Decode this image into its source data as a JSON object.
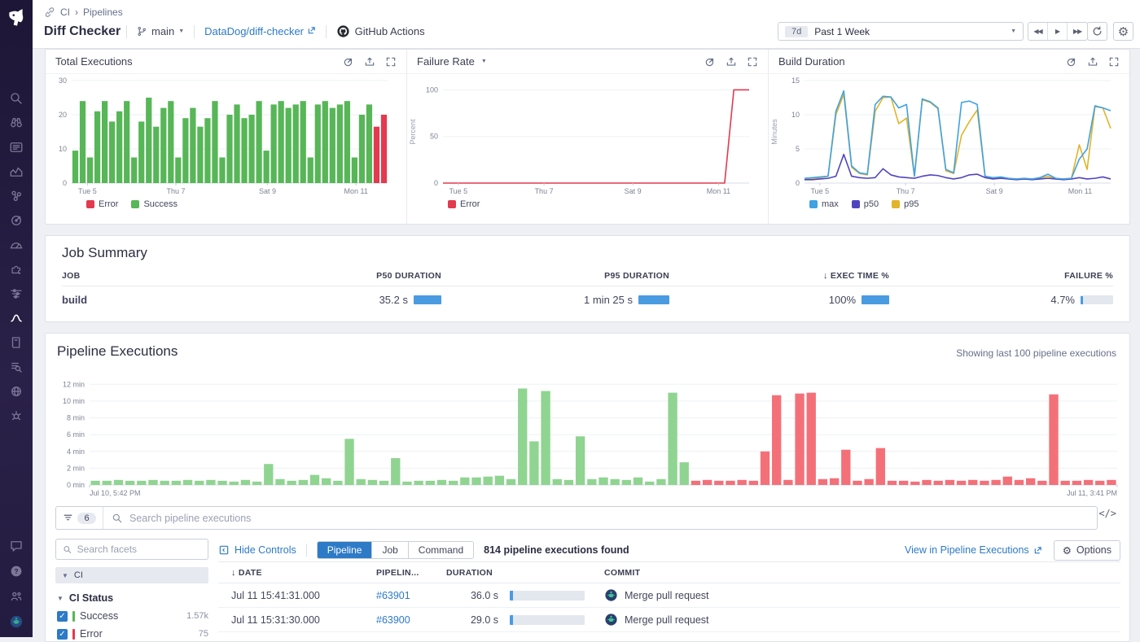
{
  "header": {
    "breadcrumb": {
      "section": "CI",
      "separator": "›",
      "page": "Pipelines"
    },
    "title": "Diff Checker",
    "branch_label": "main",
    "repo_link_label": "DataDog/diff-checker",
    "provider_label": "GitHub Actions",
    "time": {
      "badge": "7d",
      "label": "Past 1 Week"
    }
  },
  "icons": {
    "sort_desc": "↓",
    "check": "✓",
    "caret_down": "▼",
    "code": "</>",
    "gear": "⚙",
    "play": "▶",
    "rew": "◀◀",
    "ffwd": "▶▶",
    "help": "?"
  },
  "chart_data": [
    {
      "name": "total-executions",
      "type": "bar",
      "title": "Total Executions",
      "ylim": [
        0,
        30
      ],
      "yticks": [
        0,
        10,
        20,
        30
      ],
      "xticks": [
        {
          "label": "Tue 5",
          "x": 5
        },
        {
          "label": "Thu 7",
          "x": 33
        },
        {
          "label": "Sat 9",
          "x": 62
        },
        {
          "label": "Mon 11",
          "x": 90
        }
      ],
      "colors": {
        "g": "#57b657",
        "r": "#e23a4f"
      },
      "bars": [
        [
          9.5,
          "g"
        ],
        [
          24,
          "g"
        ],
        [
          7.5,
          "g"
        ],
        [
          21,
          "g"
        ],
        [
          24,
          "g"
        ],
        [
          18,
          "g"
        ],
        [
          21,
          "g"
        ],
        [
          24,
          "g"
        ],
        [
          7.5,
          "g"
        ],
        [
          18,
          "g"
        ],
        [
          25,
          "g"
        ],
        [
          16.5,
          "g"
        ],
        [
          22,
          "g"
        ],
        [
          24,
          "g"
        ],
        [
          7.5,
          "g"
        ],
        [
          19,
          "g"
        ],
        [
          22,
          "g"
        ],
        [
          16.5,
          "g"
        ],
        [
          19,
          "g"
        ],
        [
          24,
          "g"
        ],
        [
          7.5,
          "g"
        ],
        [
          20,
          "g"
        ],
        [
          23,
          "g"
        ],
        [
          19,
          "g"
        ],
        [
          20,
          "g"
        ],
        [
          24,
          "g"
        ],
        [
          9.5,
          "g"
        ],
        [
          23,
          "g"
        ],
        [
          24,
          "g"
        ],
        [
          22,
          "g"
        ],
        [
          23,
          "g"
        ],
        [
          24,
          "g"
        ],
        [
          7.5,
          "g"
        ],
        [
          23,
          "g"
        ],
        [
          24,
          "g"
        ],
        [
          22,
          "g"
        ],
        [
          23,
          "g"
        ],
        [
          24,
          "g"
        ],
        [
          7.5,
          "g"
        ],
        [
          20,
          "g"
        ],
        [
          23,
          "g"
        ],
        [
          16.5,
          "r"
        ],
        [
          20,
          "r"
        ]
      ],
      "legend": [
        {
          "label": "Error",
          "color": "#e23a4f"
        },
        {
          "label": "Success",
          "color": "#57b657"
        }
      ]
    },
    {
      "name": "failure-rate",
      "type": "line",
      "title": "Failure Rate",
      "ylabel": "Percent",
      "ylim": [
        0,
        110
      ],
      "yticks": [
        0,
        50,
        100
      ],
      "xticks": [
        {
          "label": "Tue 5",
          "x": 5
        },
        {
          "label": "Thu 7",
          "x": 33
        },
        {
          "label": "Sat 9",
          "x": 62
        },
        {
          "label": "Mon 11",
          "x": 90
        }
      ],
      "series": [
        {
          "name": "Error",
          "color": "#e23a4f",
          "points": [
            [
              0,
              0
            ],
            [
              50,
              0
            ],
            [
              92,
              0
            ],
            [
              95,
              100
            ],
            [
              100,
              100
            ]
          ]
        }
      ],
      "legend": [
        {
          "label": "Error",
          "color": "#e23a4f"
        }
      ]
    },
    {
      "name": "build-duration",
      "type": "line",
      "title": "Build Duration",
      "ylabel": "Minutes",
      "ylim": [
        0,
        15
      ],
      "yticks": [
        0,
        5,
        10,
        15
      ],
      "xticks": [
        {
          "label": "Tue 5",
          "x": 5
        },
        {
          "label": "Thu 7",
          "x": 33
        },
        {
          "label": "Sat 9",
          "x": 62
        },
        {
          "label": "Mon 11",
          "x": 90
        }
      ],
      "series": [
        {
          "name": "p95",
          "color": "#e3b32a",
          "values": [
            0.6,
            0.7,
            0.8,
            1.0,
            10.0,
            13.0,
            2.3,
            1.4,
            1.2,
            10.5,
            12.5,
            12.6,
            8.7,
            9.5,
            1.0,
            12.2,
            11.8,
            10.9,
            1.8,
            1.4,
            7.0,
            9.0,
            10.7,
            0.9,
            0.7,
            0.8,
            0.6,
            0.6,
            0.6,
            0.6,
            0.7,
            1.0,
            0.6,
            0.6,
            0.7,
            5.6,
            2.0,
            11.2,
            11.0,
            8.0
          ]
        },
        {
          "name": "p50",
          "color": "#4f44c0",
          "values": [
            0.5,
            0.5,
            0.6,
            0.7,
            1.0,
            4.2,
            1.0,
            0.8,
            0.7,
            0.8,
            2.1,
            1.2,
            0.9,
            0.8,
            0.7,
            1.0,
            1.2,
            1.1,
            0.8,
            0.6,
            0.8,
            1.2,
            1.3,
            0.8,
            0.6,
            0.7,
            0.6,
            0.5,
            0.6,
            0.5,
            0.6,
            0.7,
            0.6,
            0.5,
            0.6,
            0.8,
            0.6,
            0.7,
            0.9,
            0.6
          ]
        },
        {
          "name": "max",
          "color": "#3fa2e2",
          "values": [
            0.7,
            0.8,
            0.9,
            1.0,
            10.5,
            13.5,
            2.5,
            1.5,
            1.3,
            11.5,
            12.7,
            12.6,
            11.0,
            11.5,
            1.0,
            12.3,
            11.9,
            11.0,
            2.0,
            1.5,
            11.8,
            12.0,
            11.5,
            1.0,
            0.8,
            0.9,
            0.7,
            0.6,
            0.7,
            0.6,
            0.8,
            1.3,
            0.7,
            0.6,
            0.7,
            3.5,
            5.0,
            11.3,
            11.0,
            10.6
          ]
        }
      ],
      "legend": [
        {
          "label": "max",
          "color": "#3fa2e2"
        },
        {
          "label": "p50",
          "color": "#4f44c0"
        },
        {
          "label": "p95",
          "color": "#e3b32a"
        }
      ]
    },
    {
      "name": "pipeline-durations",
      "type": "bar",
      "title": "Pipeline Executions durations",
      "ylim": [
        0,
        13
      ],
      "yticks": [
        0,
        2,
        4,
        6,
        8,
        10,
        12
      ],
      "ytick_suffix": " min",
      "xticks": [
        {
          "label": "Jul 10, 5:42 PM",
          "x": 0,
          "anchor": "start"
        },
        {
          "label": "Jul 11, 3:41 PM",
          "x": 100,
          "anchor": "end"
        }
      ],
      "colors": {
        "g": "#90d492",
        "r": "#f47079"
      },
      "bars": [
        [
          0.5,
          "g"
        ],
        [
          0.5,
          "g"
        ],
        [
          0.6,
          "g"
        ],
        [
          0.5,
          "g"
        ],
        [
          0.5,
          "g"
        ],
        [
          0.6,
          "g"
        ],
        [
          0.5,
          "g"
        ],
        [
          0.5,
          "g"
        ],
        [
          0.6,
          "g"
        ],
        [
          0.5,
          "g"
        ],
        [
          0.6,
          "g"
        ],
        [
          0.5,
          "g"
        ],
        [
          0.4,
          "g"
        ],
        [
          0.6,
          "g"
        ],
        [
          0.4,
          "g"
        ],
        [
          2.5,
          "g"
        ],
        [
          0.7,
          "g"
        ],
        [
          0.5,
          "g"
        ],
        [
          0.6,
          "g"
        ],
        [
          1.2,
          "g"
        ],
        [
          0.8,
          "g"
        ],
        [
          0.5,
          "g"
        ],
        [
          5.5,
          "g"
        ],
        [
          0.7,
          "g"
        ],
        [
          0.6,
          "g"
        ],
        [
          0.5,
          "g"
        ],
        [
          3.2,
          "g"
        ],
        [
          0.4,
          "g"
        ],
        [
          0.5,
          "g"
        ],
        [
          0.5,
          "g"
        ],
        [
          0.6,
          "g"
        ],
        [
          0.5,
          "g"
        ],
        [
          0.9,
          "g"
        ],
        [
          0.9,
          "g"
        ],
        [
          1.0,
          "g"
        ],
        [
          1.1,
          "g"
        ],
        [
          0.7,
          "g"
        ],
        [
          11.5,
          "g"
        ],
        [
          5.2,
          "g"
        ],
        [
          11.2,
          "g"
        ],
        [
          0.7,
          "g"
        ],
        [
          0.6,
          "g"
        ],
        [
          5.8,
          "g"
        ],
        [
          0.7,
          "g"
        ],
        [
          0.9,
          "g"
        ],
        [
          0.7,
          "g"
        ],
        [
          0.6,
          "g"
        ],
        [
          0.9,
          "g"
        ],
        [
          0.4,
          "g"
        ],
        [
          0.7,
          "g"
        ],
        [
          11.0,
          "g"
        ],
        [
          2.7,
          "g"
        ],
        [
          0.5,
          "r"
        ],
        [
          0.6,
          "r"
        ],
        [
          0.5,
          "r"
        ],
        [
          0.5,
          "r"
        ],
        [
          0.6,
          "r"
        ],
        [
          0.5,
          "r"
        ],
        [
          4.0,
          "r"
        ],
        [
          10.7,
          "r"
        ],
        [
          0.6,
          "r"
        ],
        [
          10.9,
          "r"
        ],
        [
          11.0,
          "r"
        ],
        [
          0.7,
          "r"
        ],
        [
          0.8,
          "r"
        ],
        [
          4.2,
          "r"
        ],
        [
          0.5,
          "r"
        ],
        [
          0.7,
          "r"
        ],
        [
          4.4,
          "r"
        ],
        [
          0.5,
          "r"
        ],
        [
          0.5,
          "r"
        ],
        [
          0.4,
          "r"
        ],
        [
          0.6,
          "r"
        ],
        [
          0.5,
          "r"
        ],
        [
          0.6,
          "r"
        ],
        [
          0.5,
          "r"
        ],
        [
          0.6,
          "r"
        ],
        [
          0.5,
          "r"
        ],
        [
          0.6,
          "r"
        ],
        [
          1.0,
          "r"
        ],
        [
          0.6,
          "r"
        ],
        [
          0.8,
          "r"
        ],
        [
          0.5,
          "r"
        ],
        [
          10.8,
          "r"
        ],
        [
          0.5,
          "r"
        ],
        [
          0.5,
          "r"
        ],
        [
          0.6,
          "r"
        ],
        [
          0.5,
          "r"
        ],
        [
          0.6,
          "r"
        ]
      ],
      "legend": []
    }
  ],
  "job_summary": {
    "title": "Job Summary",
    "columns": {
      "job": "JOB",
      "p50": "P50 DURATION",
      "p95": "P95 DURATION",
      "exec": "EXEC TIME %",
      "failure": "FAILURE %"
    },
    "rows": [
      {
        "job": "build",
        "p50": "35.2 s",
        "p50_bar": 34,
        "p95": "1 min 25 s",
        "p95_bar": 38,
        "exec": "100%",
        "exec_bar": 34,
        "failure": "4.7%",
        "failure_bar": 3
      }
    ]
  },
  "pipeline_section": {
    "title": "Pipeline Executions",
    "subtitle": "Showing last 100 pipeline executions",
    "filter_count": "6",
    "search_placeholder": "Search pipeline executions",
    "facets": {
      "search_placeholder": "Search facets",
      "group": "CI",
      "subgroup": "CI Status",
      "items": [
        {
          "label": "Success",
          "count": "1.57k",
          "color": "#57b657"
        },
        {
          "label": "Error",
          "count": "75",
          "color": "#e23a4f"
        }
      ]
    },
    "controls": {
      "hide": "Hide Controls",
      "tabs": [
        "Pipeline",
        "Job",
        "Command"
      ],
      "active_tab": "Pipeline",
      "count": "814 pipeline executions found",
      "view": "View in Pipeline Executions",
      "options": "Options"
    },
    "table": {
      "columns": {
        "date": "DATE",
        "pipeline": "PIPELIN...",
        "duration": "DURATION",
        "commit": "COMMIT"
      },
      "rows": [
        {
          "date": "Jul 11 15:41:31.000",
          "pipeline": "#63901",
          "duration": "36.0 s",
          "duration_bar": 4,
          "commit": "Merge pull request"
        },
        {
          "date": "Jul 11 15:31:30.000",
          "pipeline": "#63900",
          "duration": "29.0 s",
          "duration_bar": 4,
          "commit": "Merge pull request"
        }
      ]
    }
  }
}
